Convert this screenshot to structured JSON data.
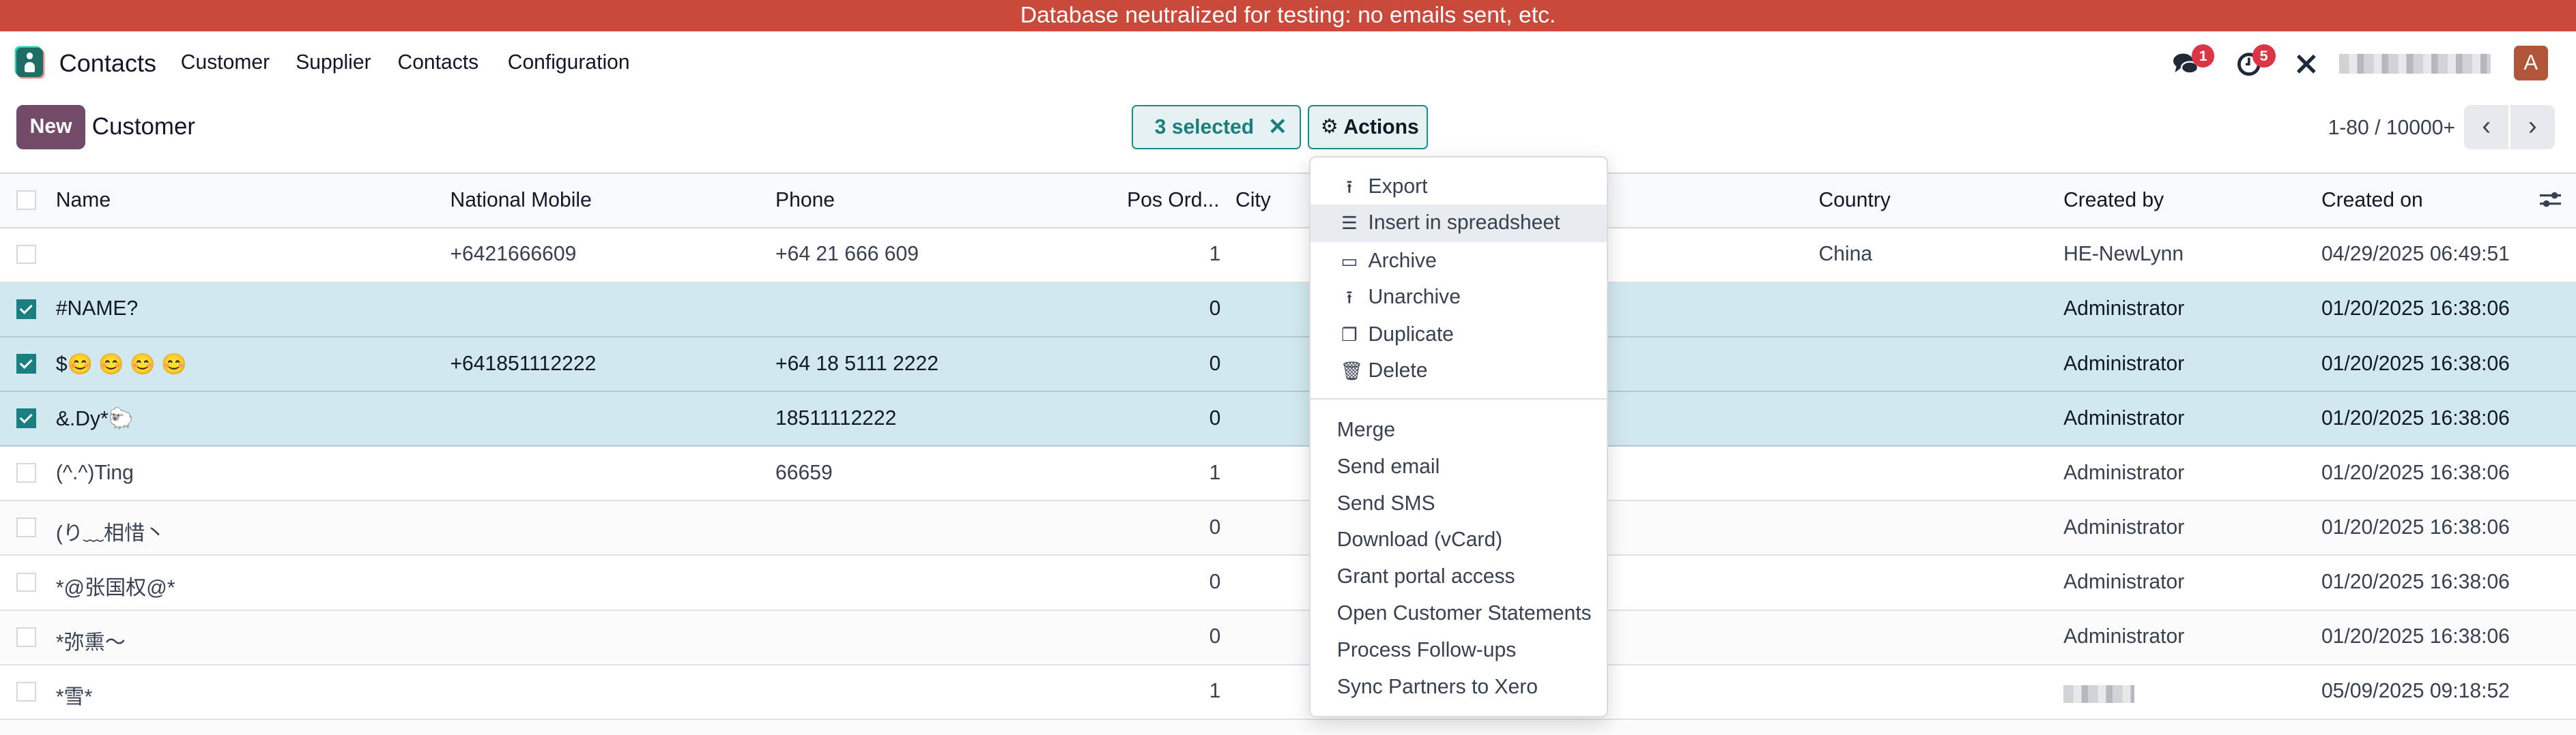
{
  "banner": "Database neutralized for testing: no emails sent, etc.",
  "nav": {
    "app": "Contacts",
    "menus": [
      "Customer",
      "Supplier",
      "Contacts",
      "Configuration"
    ],
    "messages_count": "1",
    "activities_count": "5",
    "avatar_letter": "A"
  },
  "control": {
    "new_label": "New",
    "breadcrumb": "Customer",
    "selected_label": "3 selected",
    "actions_label": "Actions",
    "pager": "1-80 / 10000+"
  },
  "columns": [
    "Name",
    "National Mobile",
    "Phone",
    "Pos Ord...",
    "City",
    "Country",
    "Created by",
    "Created on"
  ],
  "rows": [
    {
      "selected": false,
      "name": "",
      "mobile": "+6421666609",
      "phone": "+64 21 666 609",
      "pos": "1",
      "country": "China",
      "created_by": "HE-NewLynn",
      "created_on": "04/29/2025 06:49:51"
    },
    {
      "selected": true,
      "name": "#NAME?",
      "mobile": "",
      "phone": "",
      "pos": "0",
      "country": "",
      "created_by": "Administrator",
      "created_on": "01/20/2025 16:38:06"
    },
    {
      "selected": true,
      "name": "$😊 😊 😊 😊",
      "mobile": "+641851112222",
      "phone": "+64 18 5111 2222",
      "pos": "0",
      "country": "",
      "created_by": "Administrator",
      "created_on": "01/20/2025 16:38:06"
    },
    {
      "selected": true,
      "name": "&.Dy*🐑",
      "mobile": "",
      "phone": "18511112222",
      "pos": "0",
      "country": "",
      "created_by": "Administrator",
      "created_on": "01/20/2025 16:38:06"
    },
    {
      "selected": false,
      "name": "(^.^)Ting",
      "mobile": "",
      "phone": "66659",
      "pos": "1",
      "country": "",
      "created_by": "Administrator",
      "created_on": "01/20/2025 16:38:06"
    },
    {
      "selected": false,
      "name": "(り﹏相惜丶",
      "mobile": "",
      "phone": "",
      "pos": "0",
      "country": "",
      "created_by": "Administrator",
      "created_on": "01/20/2025 16:38:06"
    },
    {
      "selected": false,
      "name": "*@张国权@*",
      "mobile": "",
      "phone": "",
      "pos": "0",
      "country": "",
      "created_by": "Administrator",
      "created_on": "01/20/2025 16:38:06"
    },
    {
      "selected": false,
      "name": "*弥熏～",
      "mobile": "",
      "phone": "",
      "pos": "0",
      "country": "",
      "created_by": "Administrator",
      "created_on": "01/20/2025 16:38:06"
    },
    {
      "selected": false,
      "name": "*雪*",
      "mobile": "",
      "phone": "",
      "pos": "1",
      "country": "",
      "created_by": "",
      "created_on": "05/09/2025 09:18:52"
    }
  ],
  "actions_menu": {
    "group1": [
      {
        "label": "Export",
        "icon": "upload-icon"
      },
      {
        "label": "Insert in spreadsheet",
        "icon": "list-icon"
      },
      {
        "label": "Archive",
        "icon": "inbox-icon"
      },
      {
        "label": "Unarchive",
        "icon": "unarchive-icon"
      },
      {
        "label": "Duplicate",
        "icon": "copy-icon"
      },
      {
        "label": "Delete",
        "icon": "trash-icon"
      }
    ],
    "group2": [
      "Merge",
      "Send email",
      "Send SMS",
      "Download (vCard)",
      "Grant portal access",
      "Open Customer Statements",
      "Process Follow-ups",
      "Sync Partners to Xero"
    ]
  },
  "colors": {
    "banner": "#c9493a",
    "brand": "#714b67",
    "accent": "#1a7f80",
    "selected_row": "#d1e9ee",
    "badge": "#dc3545",
    "avatar": "#b0563a"
  }
}
